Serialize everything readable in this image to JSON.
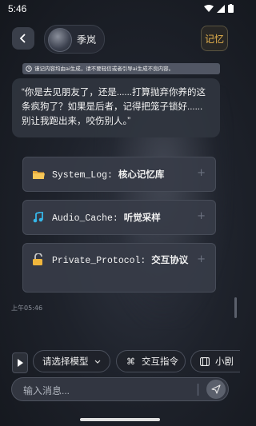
{
  "status_bar": {
    "time": "5:46"
  },
  "header": {
    "character_name": "季岚",
    "memory_label": "记忆"
  },
  "disclaimer": {
    "text": "谨记内容均由ai生成，请不要轻信或者引导ai生成不良内容。"
  },
  "message": {
    "text": "“你是去见朋友了，还是......打算抛弃你养的这条疯狗了？如果是后者，记得把笼子锁好......别让我跑出来，咬伤别人。”",
    "timestamp": "上午05:46"
  },
  "cards": [
    {
      "name": "System_Log:",
      "desc": "核心记忆库",
      "icon": "folder-icon"
    },
    {
      "name": "Audio_Cache:",
      "desc": "听觉采样",
      "icon": "music-note-icon"
    },
    {
      "name": "Private_Protocol:",
      "desc": "交互协议",
      "icon": "lock-icon"
    }
  ],
  "toolbar": {
    "model_select": "请选择模型",
    "interact_cmd": "交互指令",
    "third_chip": "小剧"
  },
  "input": {
    "placeholder": "输入消息..."
  },
  "colors": {
    "accent": "#e6b24d",
    "background": "#1e222b",
    "card": "#373c48"
  }
}
